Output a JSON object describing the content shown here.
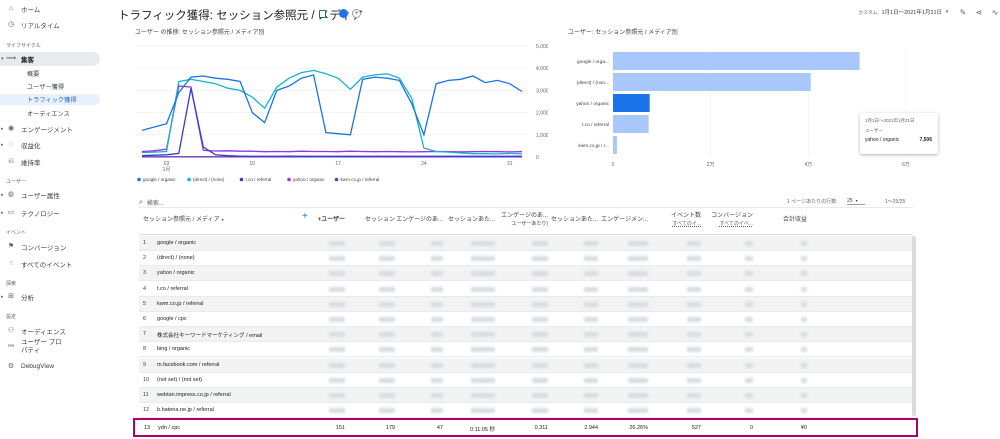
{
  "sidebar": {
    "top_items": [
      {
        "label": "ホーム",
        "icon": "home-icon"
      },
      {
        "label": "リアルタイム",
        "icon": "clock-icon"
      }
    ],
    "section_lifecycle": "ライフサイクル",
    "acquisition": {
      "label": "集客",
      "icon": "acquisition-icon"
    },
    "acquisition_sub": [
      "概要",
      "ユーザー獲得",
      "トラフィック獲得",
      "オーディエンス"
    ],
    "lifecycle_items": [
      {
        "label": "エンゲージメント",
        "icon": "engagement-icon"
      },
      {
        "label": "収益化",
        "icon": "monetization-icon"
      },
      {
        "label": "維持率",
        "icon": "retention-icon"
      }
    ],
    "section_user": "ユーザー",
    "user_items": [
      {
        "label": "ユーザー属性",
        "icon": "globe-icon"
      },
      {
        "label": "テクノロジー",
        "icon": "device-icon"
      }
    ],
    "section_event": "イベント",
    "event_items": [
      {
        "label": "コンバージョン",
        "icon": "flag-icon"
      },
      {
        "label": "すべてのイベント",
        "icon": "touch-icon"
      }
    ],
    "section_explore": "探索",
    "explore_items": [
      {
        "label": "分析",
        "icon": "analysis-icon"
      }
    ],
    "section_config": "設定",
    "config_items": [
      {
        "label": "オーディエンス",
        "icon": "audience-icon"
      },
      {
        "label": "ユーザー プロパティ",
        "icon": "user-property-icon"
      },
      {
        "label": "DebugView",
        "icon": "debug-icon"
      }
    ]
  },
  "header": {
    "title": "トラフィック獲得: セッション参照元 / メディア",
    "date_label": "カスタム",
    "date_value": "1月1日～2021年1月31日"
  },
  "line_chart": {
    "title": "ユーザー の推移: セッション参照元 / メディア別",
    "legend": [
      "google / organic",
      "(direct) / (none)",
      "t.co / referral",
      "yahoo / organic",
      "kwm.co.jp / referral"
    ]
  },
  "bar_chart": {
    "title": "ユーザー: セッション参照元 / メディア別",
    "tooltip": {
      "date": "1月1日～2021年1月31日",
      "metric": "ユーザー",
      "label": "yahoo / organic",
      "value": "7,506"
    }
  },
  "chart_data": [
    {
      "type": "line",
      "x": [
        "03 1月",
        "10",
        "17",
        "24",
        "31"
      ],
      "ylim": [
        0,
        5000
      ],
      "yticks": [
        "5,000",
        "4,000",
        "3,000",
        "2,000",
        "1,000",
        "0"
      ],
      "series": [
        {
          "name": "google / organic",
          "color": "#1a73e8",
          "values": [
            1200,
            1350,
            1500,
            2900,
            3600,
            3650,
            3550,
            3500,
            3400,
            2000,
            1550,
            3000,
            3200,
            3550,
            3700,
            1100,
            1050,
            1000,
            3500,
            3600,
            3550,
            3450,
            2400,
            1000,
            3300,
            3450,
            3500,
            3650,
            3350,
            3450,
            3300,
            2950
          ]
        },
        {
          "name": "(direct) / (none)",
          "color": "#12b5cb",
          "values": [
            200,
            220,
            250,
            3400,
            3500,
            3400,
            3300,
            3100,
            3000,
            2700,
            2200,
            3150,
            3550,
            3800,
            3900,
            3750,
            3550,
            3050,
            3600,
            3700,
            3750,
            3550,
            2650,
            400,
            250,
            220,
            180,
            150,
            150,
            140,
            160,
            140
          ]
        },
        {
          "name": "t.co / referral",
          "color": "#3c3ad6",
          "values": [
            60,
            80,
            100,
            160,
            3100,
            450,
            100,
            60,
            40,
            30,
            30,
            30,
            40,
            30,
            30,
            30,
            30,
            30,
            30,
            30,
            30,
            30,
            30,
            30,
            30,
            30,
            30,
            30,
            30,
            30,
            30,
            30
          ]
        },
        {
          "name": "yahoo / organic",
          "color": "#9334e6",
          "values": [
            250,
            280,
            350,
            3200,
            3150,
            300,
            270,
            280,
            260,
            260,
            240,
            250,
            240,
            260,
            250,
            250,
            240,
            260,
            250,
            240,
            250,
            240,
            230,
            240,
            250,
            240,
            230,
            240,
            250,
            240,
            230,
            240
          ]
        },
        {
          "name": "kwm.co.jp / referral",
          "color": "#673ab7",
          "values": [
            10,
            10,
            10,
            10,
            10,
            10,
            10,
            10,
            10,
            10,
            10,
            10,
            10,
            10,
            10,
            10,
            10,
            10,
            10,
            10,
            10,
            10,
            10,
            10,
            10,
            10,
            10,
            10,
            10,
            10,
            10,
            10
          ]
        }
      ]
    },
    {
      "type": "bar",
      "orientation": "horizontal",
      "categories": [
        "google / orga...",
        "(direct) / (non...",
        "yahoo / organic",
        "t.co / referral",
        "kwm.co.jp / r..."
      ],
      "values": [
        50500,
        40500,
        7506,
        7300,
        800
      ],
      "xticks": [
        "0",
        "2万",
        "4万",
        "6万"
      ],
      "xlim": [
        0,
        60000
      ],
      "highlight_index": 2
    }
  ],
  "table": {
    "search_placeholder": "検索...",
    "rows_per_page_label": "1 ページあたりの行数:",
    "rows_per_page_value": "25",
    "pagination": "1～25/25",
    "dimension_header": "セッション参照元 / メディア",
    "headers": [
      {
        "line1": "+ユーザー",
        "line2": ""
      },
      {
        "line1": "セッション",
        "line2": ""
      },
      {
        "line1": "エンゲージのあ...",
        "line2": ""
      },
      {
        "line1": "セッションあた...",
        "line2": ""
      },
      {
        "line1": "エンゲージのあ...",
        "line2": "ユーザーあたり)"
      },
      {
        "line1": "セッションあた...",
        "line2": ""
      },
      {
        "line1": "エンゲージメン...",
        "line2": ""
      },
      {
        "line1": "イベント数",
        "line2": "すべてのイ..."
      },
      {
        "line1": "コンバージョン",
        "line2": "すべてのイベ..."
      },
      {
        "line1": "合計収益",
        "line2": ""
      }
    ],
    "rows": [
      {
        "n": "1",
        "source": "google / organic"
      },
      {
        "n": "2",
        "source": "(direct) / (none)"
      },
      {
        "n": "3",
        "source": "yahoo / organic"
      },
      {
        "n": "4",
        "source": "t.co / referral"
      },
      {
        "n": "5",
        "source": "kwm.co.jp / referral"
      },
      {
        "n": "6",
        "source": "google / cpc"
      },
      {
        "n": "7",
        "source": "株式会社キーワードマーケティング / email"
      },
      {
        "n": "8",
        "source": "bing / organic"
      },
      {
        "n": "9",
        "source": "m.facebook.com / referral"
      },
      {
        "n": "10",
        "source": "(not set) / (not set)"
      },
      {
        "n": "11",
        "source": "webtan.impress.co.jp / referral"
      },
      {
        "n": "12",
        "source": "b.hatena.ne.jp / referral"
      }
    ],
    "highlight_row": {
      "n": "13",
      "source": "ydn / cpc",
      "values": [
        "151",
        "179",
        "47",
        "0:11:05 秒",
        "0.311",
        "2.944",
        "26.26%",
        "527",
        "0",
        "¥0"
      ]
    },
    "highlight_color": "#b0006e"
  }
}
